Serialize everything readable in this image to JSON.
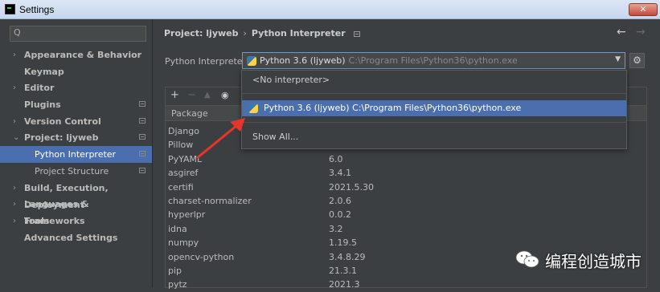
{
  "window": {
    "title": "Settings",
    "close_glyph": "✕"
  },
  "sidebar": {
    "search_placeholder": "",
    "search_icon_glyph": "Q",
    "items": [
      {
        "label": "Appearance & Behavior",
        "expand": "›"
      },
      {
        "label": "Keymap",
        "expand": ""
      },
      {
        "label": "Editor",
        "expand": "›"
      },
      {
        "label": "Plugins",
        "expand": ""
      },
      {
        "label": "Version Control",
        "expand": "›"
      },
      {
        "label": "Project: ljyweb",
        "expand": "⌄"
      },
      {
        "label": "Python Interpreter",
        "expand": ""
      },
      {
        "label": "Project Structure",
        "expand": ""
      },
      {
        "label": "Build, Execution, Deployment",
        "expand": "›"
      },
      {
        "label": "Languages & Frameworks",
        "expand": "›"
      },
      {
        "label": "Tools",
        "expand": "›"
      },
      {
        "label": "Advanced Settings",
        "expand": ""
      }
    ]
  },
  "header": {
    "breadcrumb_project": "Project: ljyweb",
    "breadcrumb_sep": "›",
    "breadcrumb_page": "Python Interpreter",
    "back_glyph": "←",
    "forward_glyph": "→"
  },
  "interpreter": {
    "label": "Python Interpreter:",
    "selected_name": "Python 3.6 (ljyweb)",
    "selected_path": "C:\\Program Files\\Python36\\python.exe",
    "arrow_glyph": "▼",
    "gear_glyph": "⚙"
  },
  "dropdown": {
    "no_interpreter": "<No interpreter>",
    "option_label": "Python 3.6 (ljyweb) C:\\Program Files\\Python36\\python.exe",
    "show_all": "Show All..."
  },
  "packages": {
    "toolbar": {
      "add": "+",
      "remove": "−",
      "upgrade": "▲",
      "show": "◉"
    },
    "column_header": "Package",
    "rows": [
      {
        "name": "Django",
        "version": ""
      },
      {
        "name": "Pillow",
        "version": ""
      },
      {
        "name": "PyYAML",
        "version": "6.0"
      },
      {
        "name": "asgiref",
        "version": "3.4.1"
      },
      {
        "name": "certifi",
        "version": "2021.5.30"
      },
      {
        "name": "charset-normalizer",
        "version": "2.0.6"
      },
      {
        "name": "hyperlpr",
        "version": "0.0.2"
      },
      {
        "name": "idna",
        "version": "3.2"
      },
      {
        "name": "numpy",
        "version": "1.19.5"
      },
      {
        "name": "opencv-python",
        "version": "3.4.8.29"
      },
      {
        "name": "pip",
        "version": "21.3.1"
      },
      {
        "name": "pytz",
        "version": "2021.3"
      }
    ]
  },
  "watermark": {
    "text": "编程创造城市"
  },
  "colors": {
    "accent": "#4b6eaf",
    "background": "#3c3f41",
    "annotation": "#e8352c"
  }
}
